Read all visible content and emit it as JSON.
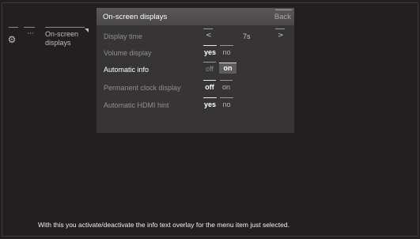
{
  "breadcrumb": {
    "dots": "···",
    "label": "On-screen displays"
  },
  "panel": {
    "title": "On-screen displays",
    "back_label": "Back",
    "rows": [
      {
        "label": "Display time",
        "left_arrow": "<",
        "value": "7s",
        "right_arrow": ">"
      },
      {
        "label": "Volume display",
        "options": [
          "yes",
          "no"
        ],
        "selected": "yes"
      },
      {
        "label": "Automatic info",
        "options": [
          "off",
          "on"
        ],
        "selected": "on"
      },
      {
        "label": "Permanent clock display",
        "options": [
          "off",
          "on"
        ],
        "selected": "off"
      },
      {
        "label": "Automatic HDMI hint",
        "options": [
          "yes",
          "no"
        ],
        "selected": "yes"
      }
    ]
  },
  "footer_text": "With this you activate/deactivate the info text overlay for the menu item just selected."
}
